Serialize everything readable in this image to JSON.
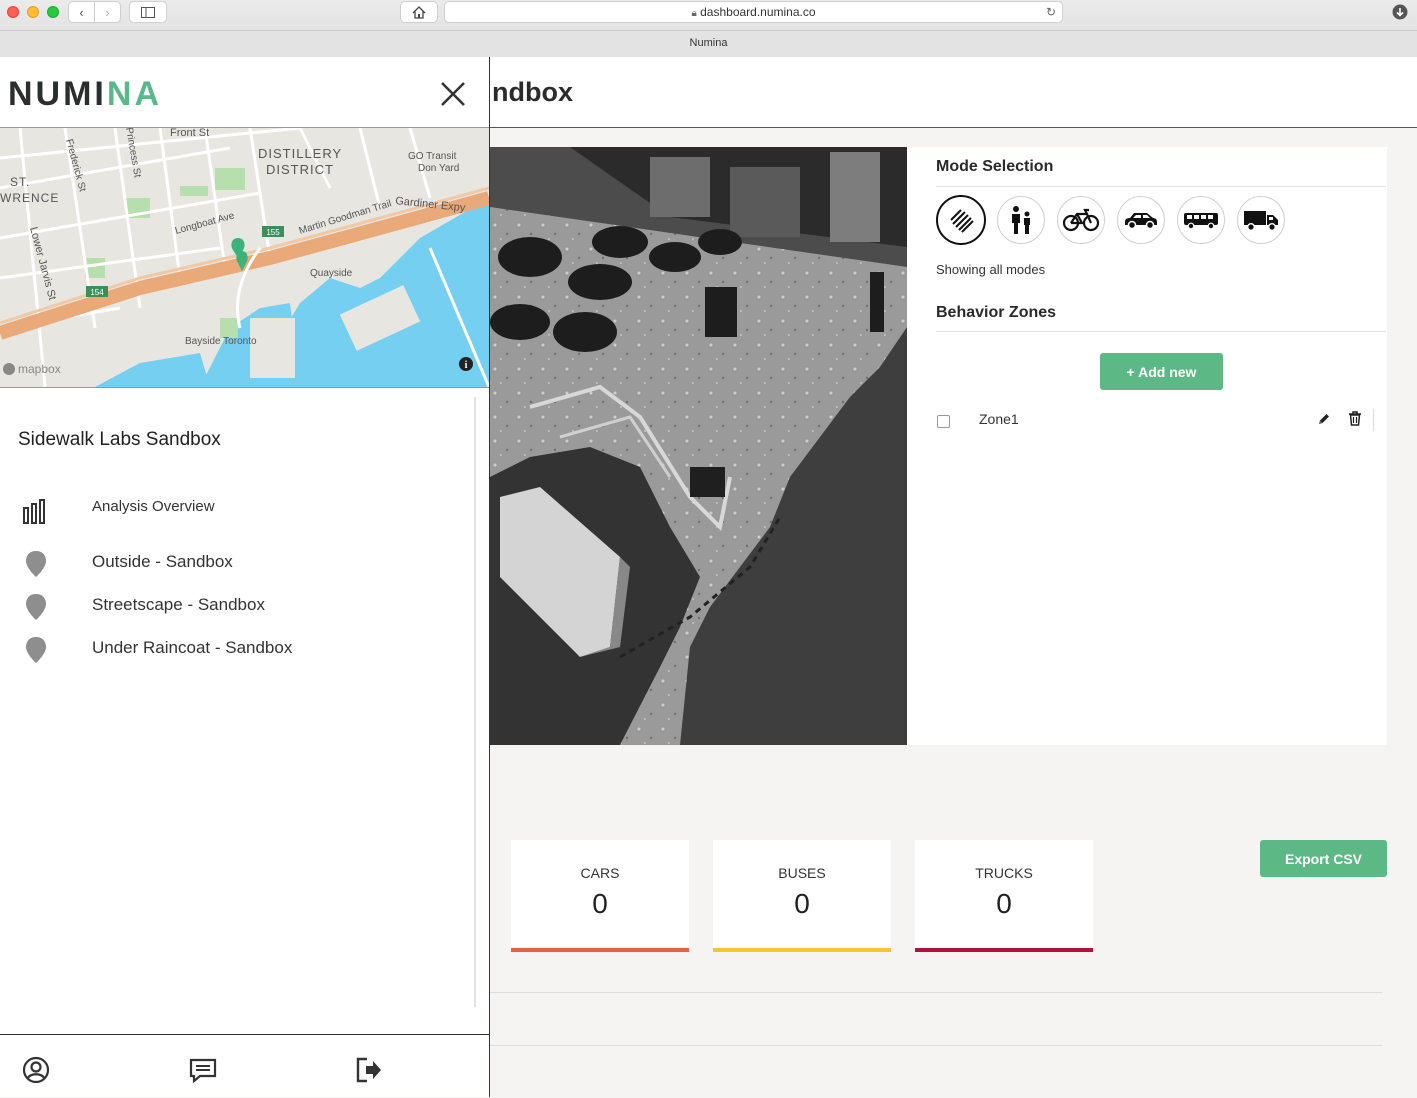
{
  "browser": {
    "url": "dashboard.numina.co",
    "tab_title": "Numina"
  },
  "sidebar": {
    "logo": {
      "part1": "NUMI",
      "part2": "N",
      "part3": "A"
    },
    "map": {
      "labels": [
        "Front St",
        "Frederick St",
        "Princess St",
        "ST.",
        "WRENCE",
        "DISTILLERY",
        "DISTRICT",
        "GO Transit",
        "Don Yard",
        "Gardiner Expy",
        "Longboat Ave",
        "Martin Goodman Trail",
        "Lower Jarvis St",
        "Quayside",
        "Bayside Toronto",
        "mapbox"
      ],
      "route_badges": [
        "155",
        "154"
      ]
    },
    "site_title": "Sidewalk Labs Sandbox",
    "nav": [
      {
        "label": "Analysis Overview",
        "icon": "bar-chart-icon"
      },
      {
        "label": "Outside - Sandbox",
        "icon": "location-pin-icon"
      },
      {
        "label": "Streetscape - Sandbox",
        "icon": "location-pin-icon"
      },
      {
        "label": "Under Raincoat - Sandbox",
        "icon": "location-pin-icon"
      }
    ],
    "footer_icons": [
      "user-account-icon",
      "feedback-icon",
      "logout-icon"
    ]
  },
  "header": {
    "title": "ndbox"
  },
  "mode_selection": {
    "heading": "Mode Selection",
    "modes": [
      "all-modes-icon",
      "pedestrian-icon",
      "bicycle-icon",
      "car-icon",
      "bus-icon",
      "truck-icon"
    ],
    "active_mode": "all-modes-icon",
    "status": "Showing all modes"
  },
  "behavior_zones": {
    "heading": "Behavior Zones",
    "add_label": "+ Add new",
    "zones": [
      {
        "name": "Zone1",
        "checked": false
      }
    ]
  },
  "stats": [
    {
      "label": "CARS",
      "value": "0",
      "color": "#e8604c"
    },
    {
      "label": "BUSES",
      "value": "0",
      "color": "#f2c832"
    },
    {
      "label": "TRUCKS",
      "value": "0",
      "color": "#b3123e"
    }
  ],
  "export_label": "Export CSV",
  "colors": {
    "accent_green": "#5cb885",
    "logo_green": "#59b98a"
  }
}
